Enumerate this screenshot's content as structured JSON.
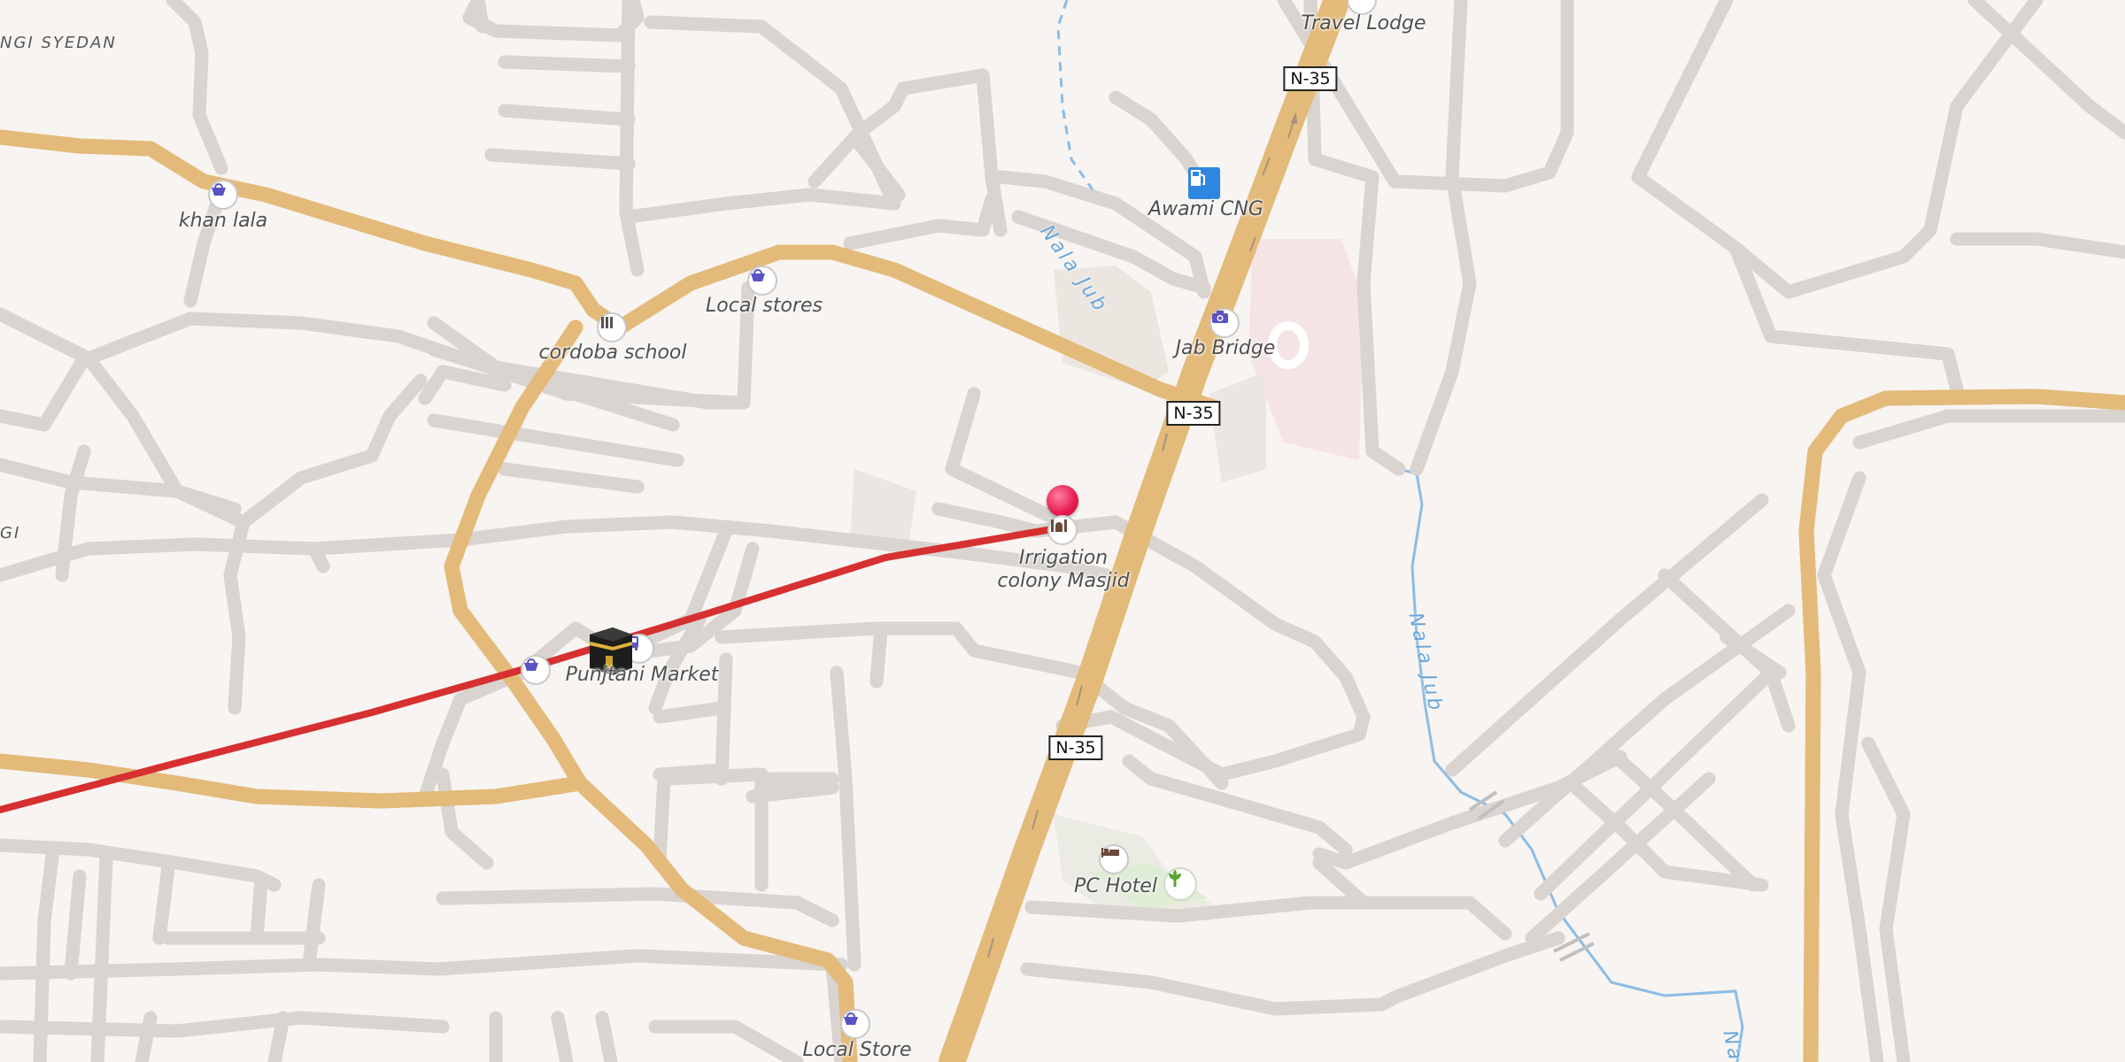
{
  "map": {
    "areas": [
      {
        "id": "area-top-left",
        "text": "NGI SYEDAN"
      },
      {
        "id": "area-left",
        "text": "GI"
      }
    ],
    "pois": [
      {
        "id": "travel-lodge",
        "label": "Travel Lodge",
        "icon": "hotel-icon"
      },
      {
        "id": "awami-cng",
        "label": "Awami CNG",
        "icon": "fuel-icon"
      },
      {
        "id": "khan-lala",
        "label": "khan lala",
        "icon": "shopping-basket-icon"
      },
      {
        "id": "local-stores",
        "label": "Local stores",
        "icon": "shopping-basket-icon"
      },
      {
        "id": "cordoba-school",
        "label": "cordoba school",
        "icon": "school-icon"
      },
      {
        "id": "jab-bridge",
        "label": "Jab Bridge",
        "icon": "camera-icon"
      },
      {
        "id": "irrigation-masjid",
        "label": "Irrigation\ncolony Masjid",
        "icon": "mosque-icon"
      },
      {
        "id": "punjtani-market",
        "label": "Punjtani Market",
        "icon": "shopping-basket-icon"
      },
      {
        "id": "pc-hotel",
        "label": "PC Hotel",
        "icon": "bed-icon"
      },
      {
        "id": "local-store",
        "label": "Local Store",
        "icon": "shopping-basket-icon"
      }
    ],
    "road_shields": [
      "N-35",
      "N-35",
      "N-35"
    ],
    "waterways": [
      "Nala Jub",
      "Nala Jub",
      "Na"
    ],
    "route_color": "#d63031",
    "marker_color": "#e8194f",
    "main_road_color": "#fbd98a",
    "water_color": "#8cbce6"
  }
}
